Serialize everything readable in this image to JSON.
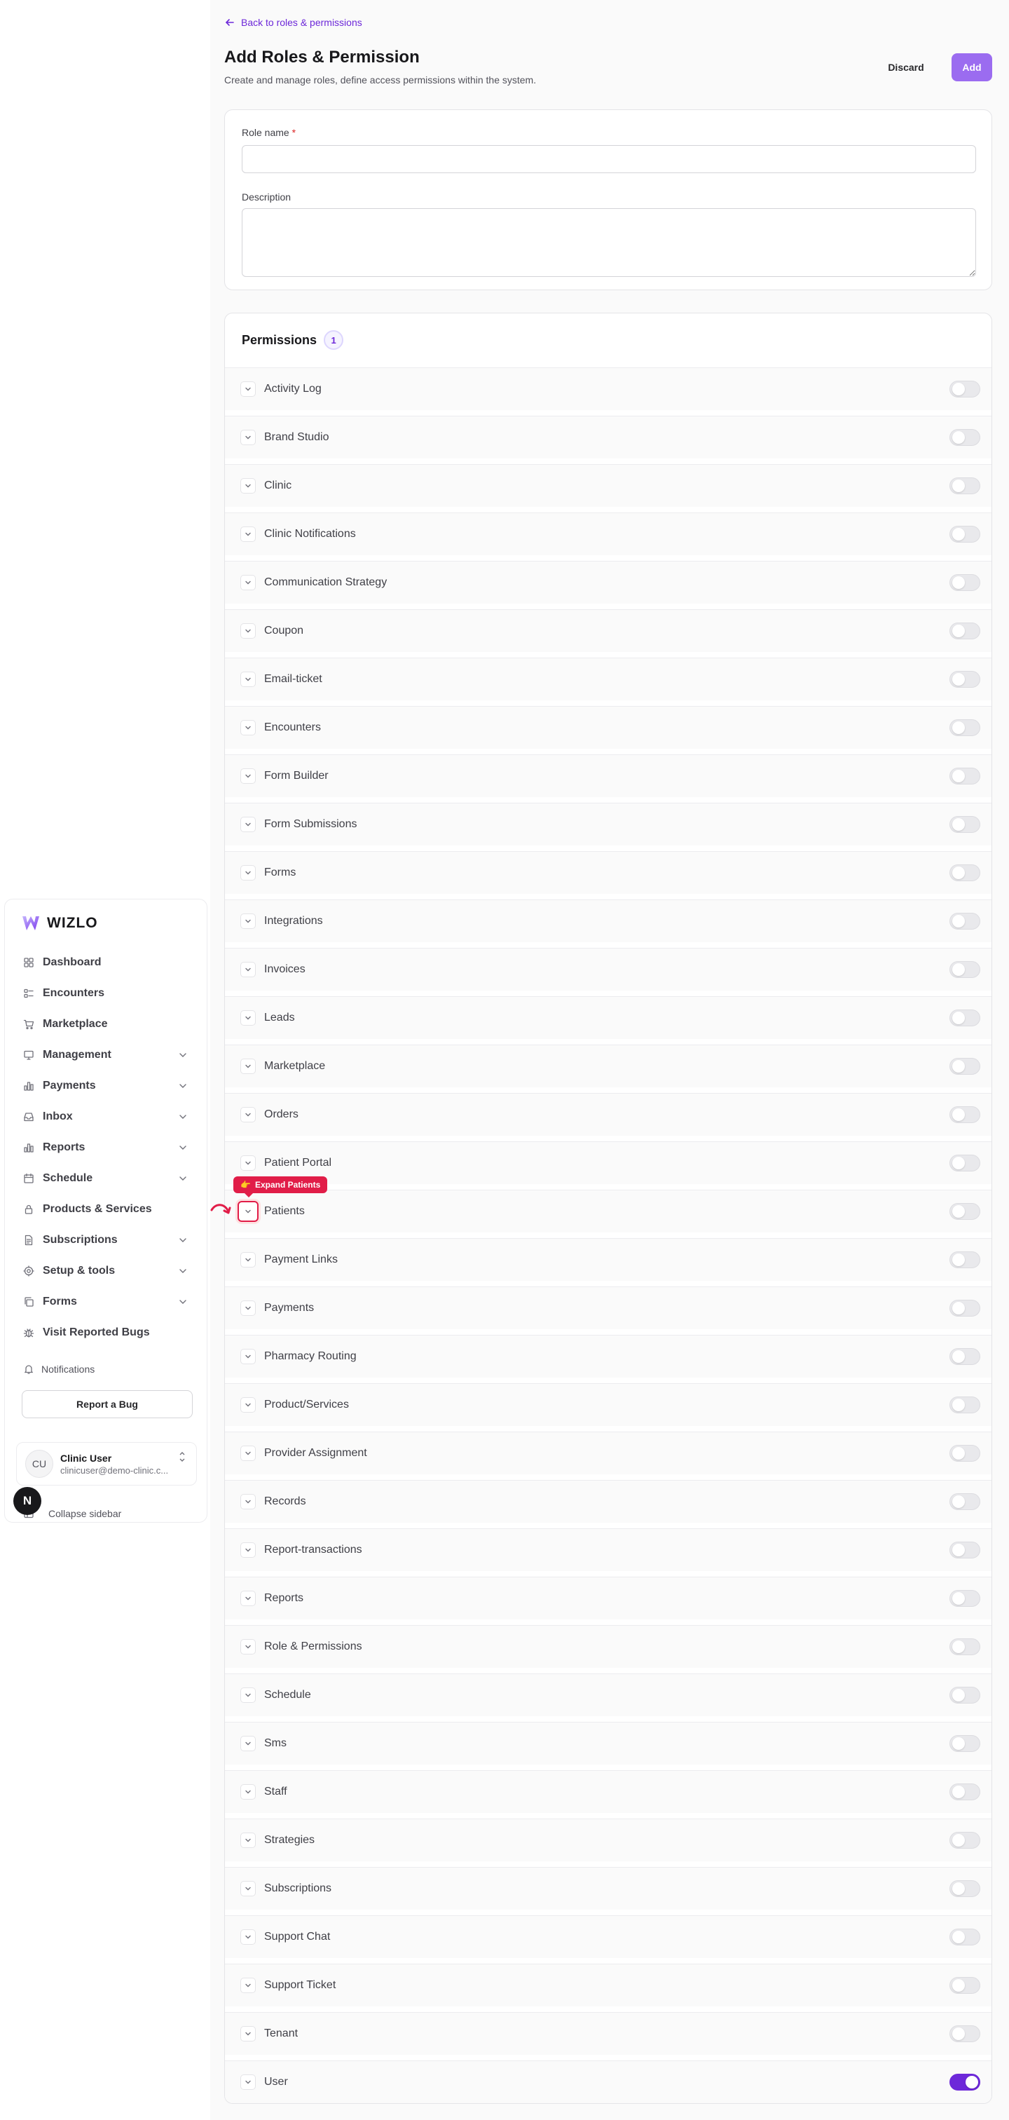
{
  "colors": {
    "accent": "#6d28d9",
    "accent_light": "#9b6cf0",
    "highlight": "#e11d48"
  },
  "sidebar": {
    "brand": "WIZLO",
    "items": [
      {
        "label": "Dashboard",
        "icon": "dashboard-icon",
        "has_chevron": false
      },
      {
        "label": "Encounters",
        "icon": "encounters-icon",
        "has_chevron": false
      },
      {
        "label": "Marketplace",
        "icon": "cart-icon",
        "has_chevron": false
      },
      {
        "label": "Management",
        "icon": "monitor-icon",
        "has_chevron": true
      },
      {
        "label": "Payments",
        "icon": "bar-chart-icon",
        "has_chevron": true
      },
      {
        "label": "Inbox",
        "icon": "inbox-icon",
        "has_chevron": true
      },
      {
        "label": "Reports",
        "icon": "bar-chart-icon",
        "has_chevron": true
      },
      {
        "label": "Schedule",
        "icon": "calendar-icon",
        "has_chevron": true
      },
      {
        "label": "Products & Services",
        "icon": "lock-icon",
        "has_chevron": false
      },
      {
        "label": "Subscriptions",
        "icon": "document-icon",
        "has_chevron": true
      },
      {
        "label": "Setup & tools",
        "icon": "gear-icon",
        "has_chevron": true
      },
      {
        "label": "Forms",
        "icon": "copy-icon",
        "has_chevron": true
      },
      {
        "label": "Visit Reported Bugs",
        "icon": "bug-icon",
        "has_chevron": false
      }
    ],
    "notifications_label": "Notifications",
    "report_bug_label": "Report a Bug",
    "user": {
      "initials": "CU",
      "name": "Clinic User",
      "email": "clinicuser@demo-clinic.c..."
    },
    "collapse_label": "Collapse sidebar",
    "badge_letter": "N"
  },
  "header": {
    "back_label": "Back to roles & permissions",
    "title": "Add Roles & Permission",
    "subtitle": "Create and manage roles, define access permissions within the system.",
    "discard_label": "Discard",
    "add_label": "Add"
  },
  "form": {
    "role_name_label": "Role name",
    "required_mark": "*",
    "role_name_value": "",
    "description_label": "Description",
    "description_value": ""
  },
  "permissions": {
    "title": "Permissions",
    "count": "1",
    "tooltip": "Expand Patients",
    "tooltip_emoji": "👉",
    "items": [
      {
        "label": "Activity Log",
        "enabled": false
      },
      {
        "label": "Brand Studio",
        "enabled": false
      },
      {
        "label": "Clinic",
        "enabled": false
      },
      {
        "label": "Clinic Notifications",
        "enabled": false
      },
      {
        "label": "Communication Strategy",
        "enabled": false
      },
      {
        "label": "Coupon",
        "enabled": false
      },
      {
        "label": "Email-ticket",
        "enabled": false
      },
      {
        "label": "Encounters",
        "enabled": false
      },
      {
        "label": "Form Builder",
        "enabled": false
      },
      {
        "label": "Form Submissions",
        "enabled": false
      },
      {
        "label": "Forms",
        "enabled": false
      },
      {
        "label": "Integrations",
        "enabled": false
      },
      {
        "label": "Invoices",
        "enabled": false
      },
      {
        "label": "Leads",
        "enabled": false
      },
      {
        "label": "Marketplace",
        "enabled": false
      },
      {
        "label": "Orders",
        "enabled": false
      },
      {
        "label": "Patient Portal",
        "enabled": false
      },
      {
        "label": "Patients",
        "enabled": false,
        "highlighted": true
      },
      {
        "label": "Payment Links",
        "enabled": false
      },
      {
        "label": "Payments",
        "enabled": false
      },
      {
        "label": "Pharmacy Routing",
        "enabled": false
      },
      {
        "label": "Product/Services",
        "enabled": false
      },
      {
        "label": "Provider Assignment",
        "enabled": false
      },
      {
        "label": "Records",
        "enabled": false
      },
      {
        "label": "Report-transactions",
        "enabled": false
      },
      {
        "label": "Reports",
        "enabled": false
      },
      {
        "label": "Role & Permissions",
        "enabled": false
      },
      {
        "label": "Schedule",
        "enabled": false
      },
      {
        "label": "Sms",
        "enabled": false
      },
      {
        "label": "Staff",
        "enabled": false
      },
      {
        "label": "Strategies",
        "enabled": false
      },
      {
        "label": "Subscriptions",
        "enabled": false
      },
      {
        "label": "Support Chat",
        "enabled": false
      },
      {
        "label": "Support Ticket",
        "enabled": false
      },
      {
        "label": "Tenant",
        "enabled": false
      },
      {
        "label": "User",
        "enabled": true
      }
    ]
  }
}
